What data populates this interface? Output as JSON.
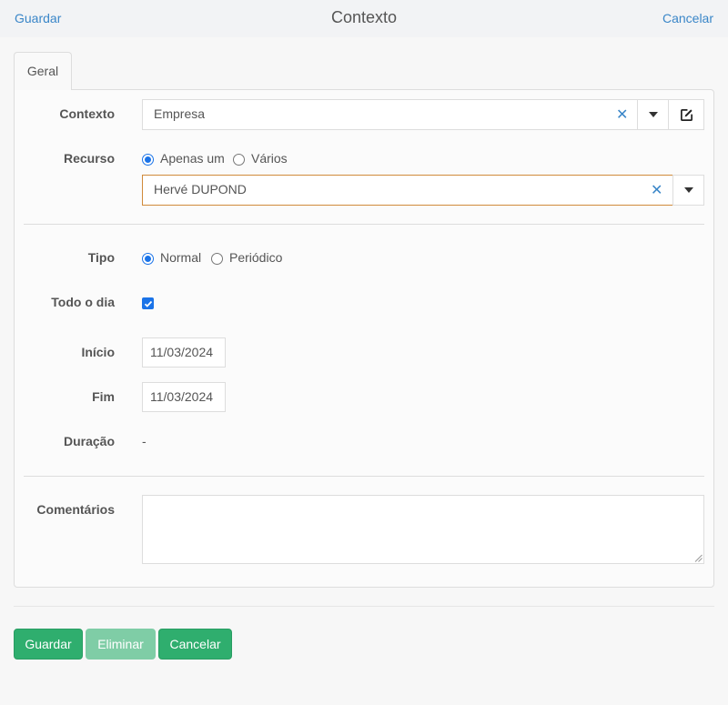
{
  "header": {
    "left_link": "Guardar",
    "title": "Contexto",
    "right_link": "Cancelar"
  },
  "tabs": [
    {
      "label": "Geral",
      "active": true
    }
  ],
  "form": {
    "contexto": {
      "label": "Contexto",
      "value": "Empresa"
    },
    "recurso": {
      "label": "Recurso",
      "options": [
        "Apenas um",
        "Vários"
      ],
      "selected": "Apenas um",
      "value": "Hervé DUPOND"
    },
    "tipo": {
      "label": "Tipo",
      "options": [
        "Normal",
        "Periódico"
      ],
      "selected": "Normal"
    },
    "todo_o_dia": {
      "label": "Todo o dia",
      "checked": true
    },
    "inicio": {
      "label": "Início",
      "value": "11/03/2024"
    },
    "fim": {
      "label": "Fim",
      "value": "11/03/2024"
    },
    "duracao": {
      "label": "Duração",
      "value": "-"
    },
    "comentarios": {
      "label": "Comentários",
      "value": ""
    }
  },
  "footer": {
    "save_label": "Guardar",
    "delete_label": "Eliminar",
    "cancel_label": "Cancelar"
  },
  "colors": {
    "accent": "#3a86c8",
    "success": "#2fae6e",
    "success_disabled": "#7fcda6",
    "focus_border": "#d08a3a"
  },
  "icons": [
    "clear-icon",
    "chevron-down-icon",
    "edit-icon"
  ]
}
